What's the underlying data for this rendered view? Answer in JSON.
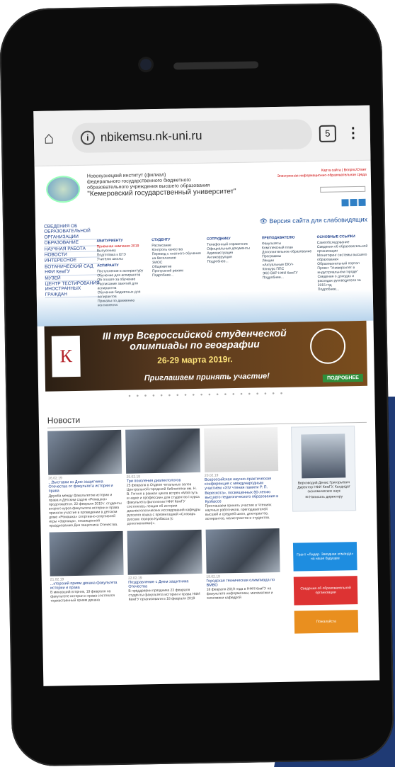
{
  "browser": {
    "url": "nbikemsu.nk-uni.ru",
    "tab_count": "5"
  },
  "site": {
    "institute_line1": "Новокузнецкий институт (филиал)",
    "institute_line2": "федерального государственного бюджетного",
    "institute_line3": "образовательного учреждения высшего образования",
    "university_name": "\"Кемеровский государственный университет\"",
    "top_links_1": "Карта сайта | Вопрос/Ответ",
    "top_links_2": "Электронная информационно-образовательная среда",
    "low_vision_link": "Версия сайта для слабовидящих"
  },
  "left_menu": [
    "СВЕДЕНИЯ ОБ ОБРАЗОВАТЕЛЬНОЙ ОРГАНИЗАЦИИ",
    "ОБРАЗОВАНИЕ",
    "НАУЧНАЯ РАБОТА",
    "НОВОСТИ",
    "ИНТЕРЕСНОЕ",
    "БОТАНИЧЕСКИЙ САД НФИ КемГУ",
    "МУЗЕЙ",
    "ЦЕНТР ТЕСТИРОВАНИЯ ИНОСТРАННЫХ ГРАЖДАН"
  ],
  "menu_columns": [
    {
      "heading": "АБИТУРИЕНТУ",
      "items": [
        "Приемная кампания 2019",
        "Выпускнику",
        "Подготовка к ЕГЭ",
        "Учителю школы"
      ],
      "heading2": "АСПИРАНТУ",
      "items2": [
        "Поступление в аспирантуру",
        "Обучение для аспирантов",
        "Об оплате за обучение",
        "Расписание занятий для аспирантов",
        "Обучение бюджетных для аспирантов",
        "Приказы по движению контингента"
      ]
    },
    {
      "heading": "СТУДЕНТУ",
      "items": [
        "Расписание",
        "Контроль качества",
        "Перевод с платного обучения на бесплатное",
        "ЭИОС",
        "Общежитие",
        "Пропускной режим",
        "Подробнее..."
      ]
    },
    {
      "heading": "СОТРУДНИКУ",
      "items": [
        "Телефонный справочник",
        "Официальные документы",
        "Администрация",
        "Антикоррупция",
        "Подробнее..."
      ]
    },
    {
      "heading": "ПРЕПОДАВАТЕЛЮ",
      "items": [
        "Факультеты",
        "Комплексный план",
        "Дополнительное образование",
        "Программы",
        "Лекции",
        "«Актуальные ЕКУ»",
        "Конкурс ППС",
        "ЭКС ВКР НФИ КемГУ",
        "Подробнее..."
      ]
    },
    {
      "heading": "ОСНОВНЫЕ ССЫЛКИ",
      "items": [
        "Самообследование",
        "Сведения об образовательной организации",
        "Мониторинг системы высшего образования",
        "Образовательный портал",
        "Проект \"Университет в индустриальном городе\"",
        "Сведения о доходах и расходах руководителя за 2015 год",
        "Подробнее..."
      ]
    }
  ],
  "banner": {
    "logo_letter": "К",
    "title": "III тур Всероссийской студенческой олимпиады по географии",
    "dates": "26-29 марта 2019г.",
    "invite": "Приглашаем принять участие!",
    "more_label": "ПОДРОБНЕЕ"
  },
  "news": {
    "section_title": "Новости",
    "items": [
      {
        "date": "26.02.19",
        "head": "...Выставки ко Дню защитника Отечества от факультета истории и права",
        "body": "Дружба между факультетом истории и права и Детским садом «Ромашка» продолжается. 22 февраля 2019 г. студенты второго курса факультета истории и права приняли участие в проведении в детском доме «Ромашка» спортивно-спортивной игры «Зарница», посвященной празднованию Дня защитника Отечества."
      },
      {
        "date": "25.02.19",
        "head": "Три поколения диалектологов",
        "body": "25 февраля в Отделе читальных залов Центральной городской библиотеки им. Н. В. Гоголя в рамках цикла встреч «Мой путь в науке и профессии» для студентов I курса факультета филологии НФИ КемГУ состоялась лекция об истории диалектологических исследований кафедры русского языка с презентацией «Словарь русских говоров Кузбасса (с дополнениями)»."
      },
      {
        "date": "20.02.19",
        "head": "Всероссийская научно-практическая конференция с международным участием «XIV чтения памяти Р. П. Верескота», посвященных 80-летию высшего педагогического образования в Кузбассе",
        "body": "Приглашаем принять участие в Чтениях научных работников, преподавателей высшей и средней школ, докторантов, аспирантов, магистрантов и студентов."
      },
      {
        "date": "21.02.19",
        "head": "...кторский прием декана факультета истории и права",
        "body": "В минувший вторник, 19 февраля на факультете истории и права состоялся торжественный прием декана"
      },
      {
        "date": "22.02.19",
        "head": "Поздравление с Днем защитника Отечества",
        "body": "В преддверии праздника 23 февраля студенты факультета истории и права НФИ КемГУ организовали в 18 февраля 2019"
      },
      {
        "date": "19.02.19",
        "head": "Городская техническая олимпиада по ВМВО",
        "body": "18 февраля 2019 года в НФИ КемГУ на факультете информатики, математики и экономики кафедрой"
      }
    ]
  },
  "sidebar": {
    "director_name": "Верховодий Денис Григорьевич",
    "director_title": "Директор НФИ КемГУ, Кандидат экономических наук",
    "write_director": "Написать директору",
    "btn1": "Грант «Лидер. Звездная команда» на наше будущее",
    "btn2": "Сведения об образовательной организации",
    "btn3": "Пожалуйста"
  }
}
